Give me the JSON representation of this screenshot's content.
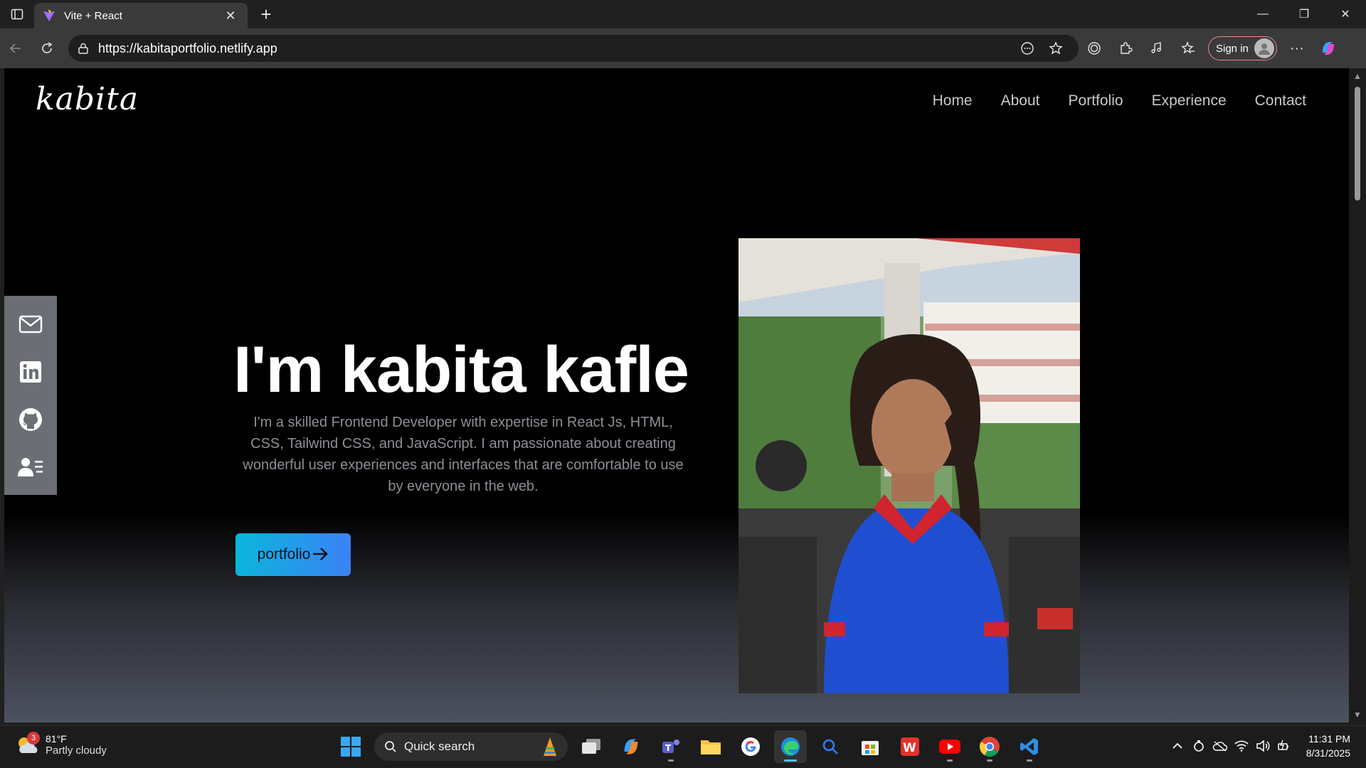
{
  "browser": {
    "tab_title": "Vite + React",
    "url": "https://kabitaportfolio.netlify.app",
    "sign_in_label": "Sign in"
  },
  "site": {
    "logo": "kabita",
    "nav": [
      "Home",
      "About",
      "Portfolio",
      "Experience",
      "Contact"
    ],
    "social_icons": [
      "mail-icon",
      "linkedin-icon",
      "github-icon",
      "resume-icon"
    ],
    "hero_title": "I'm kabita kafle",
    "hero_description": "I'm a skilled Frontend Developer with expertise in React Js, HTML, CSS, Tailwind CSS, and JavaScript. I am passionate about creating wonderful user experiences and interfaces that are comfortable to use by everyone in the web.",
    "cta_label": "portfolio",
    "accent_gradient": [
      "#0bb5da",
      "#3b82f6"
    ]
  },
  "taskbar": {
    "weather_temp": "81°F",
    "weather_cond": "Partly cloudy",
    "weather_badge": "3",
    "search_label": "Quick search",
    "time": "11:31 PM",
    "date": "8/31/2025",
    "apps": [
      "task-view",
      "copilot",
      "teams",
      "file-explorer",
      "google",
      "edge",
      "search",
      "microsoft-store",
      "wps",
      "youtube",
      "chrome",
      "vscode"
    ]
  }
}
